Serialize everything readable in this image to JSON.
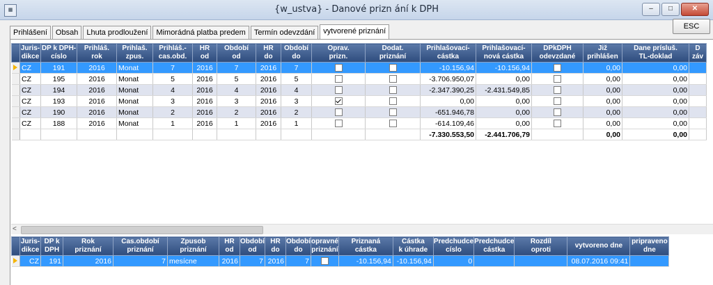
{
  "window": {
    "title": "{w_ustva} - Danové prizn ání k DPH",
    "icon": "app-window-icon"
  },
  "buttons": {
    "minimize": "–",
    "maximize": "□",
    "close": "✕",
    "esc": "ESC"
  },
  "tabs": [
    "Prihlášení",
    "Obsah",
    "Lhuta prodloužení",
    "Mimorádná platba predem",
    "Termín odevzdání",
    "vytvorené priznání"
  ],
  "top_grid": {
    "headers": [
      "Juris-\ndikce",
      "DP k DPH-\ncíslo",
      "Prihláš.\nrok",
      "Prihlaš.\nzpus.",
      "Prihláš.-\ncas.obd.",
      "HR\nod",
      "Období\nod",
      "HR\ndo",
      "Období\ndo",
      "Oprav.\nprizn.",
      "Dodat.\npriznání",
      "Prihlašovací-\ncástka",
      "Prihlašovací-\nnová cástka",
      "DPkDPH\nodevzdané",
      "Již\nprihlášen",
      "Dane prísluš.\nTL-doklad",
      "D\nzáv"
    ],
    "rows": [
      {
        "juris": "CZ",
        "dp": "191",
        "rok": "2016",
        "zpus": "Monat",
        "cas": "7",
        "hr_od": "2016",
        "ob_od": "7",
        "hr_do": "2016",
        "ob_do": "7",
        "oprav": false,
        "dodat": false,
        "castka": "-10.156,94",
        "nova": "-10.156,94",
        "odevz": false,
        "jiz": "0,00",
        "dane": "0,00"
      },
      {
        "juris": "CZ",
        "dp": "195",
        "rok": "2016",
        "zpus": "Monat",
        "cas": "5",
        "hr_od": "2016",
        "ob_od": "5",
        "hr_do": "2016",
        "ob_do": "5",
        "oprav": false,
        "dodat": false,
        "castka": "-3.706.950,07",
        "nova": "0,00",
        "odevz": false,
        "jiz": "0,00",
        "dane": "0,00"
      },
      {
        "juris": "CZ",
        "dp": "194",
        "rok": "2016",
        "zpus": "Monat",
        "cas": "4",
        "hr_od": "2016",
        "ob_od": "4",
        "hr_do": "2016",
        "ob_do": "4",
        "oprav": false,
        "dodat": false,
        "castka": "-2.347.390,25",
        "nova": "-2.431.549,85",
        "odevz": false,
        "jiz": "0,00",
        "dane": "0,00"
      },
      {
        "juris": "CZ",
        "dp": "193",
        "rok": "2016",
        "zpus": "Monat",
        "cas": "3",
        "hr_od": "2016",
        "ob_od": "3",
        "hr_do": "2016",
        "ob_do": "3",
        "oprav": true,
        "dodat": false,
        "castka": "0,00",
        "nova": "0,00",
        "odevz": false,
        "jiz": "0,00",
        "dane": "0,00"
      },
      {
        "juris": "CZ",
        "dp": "190",
        "rok": "2016",
        "zpus": "Monat",
        "cas": "2",
        "hr_od": "2016",
        "ob_od": "2",
        "hr_do": "2016",
        "ob_do": "2",
        "oprav": false,
        "dodat": false,
        "castka": "-651.946,78",
        "nova": "0,00",
        "odevz": false,
        "jiz": "0,00",
        "dane": "0,00"
      },
      {
        "juris": "CZ",
        "dp": "188",
        "rok": "2016",
        "zpus": "Monat",
        "cas": "1",
        "hr_od": "2016",
        "ob_od": "1",
        "hr_do": "2016",
        "ob_do": "1",
        "oprav": false,
        "dodat": false,
        "castka": "-614.109,46",
        "nova": "0,00",
        "odevz": false,
        "jiz": "0,00",
        "dane": "0,00"
      }
    ],
    "totals": {
      "castka": "-7.330.553,50",
      "nova": "-2.441.706,79",
      "jiz": "0,00",
      "dane": "0,00"
    }
  },
  "bottom_grid": {
    "headers": [
      "Juris-\ndikce",
      "DP k\nDPH",
      "Rok\npriznání",
      "Cas.období\npriznání",
      "Zpusob\npriznání",
      "HR\nod",
      "Období\nod",
      "HR\ndo",
      "Období\ndo",
      "opravné\npriznání",
      "Priznaná\ncástka",
      "Cástka\nk úhrade",
      "Predchudce\ncíslo",
      "Predchudce\ncástka",
      "Rozdíl\noproti",
      "vytvoreno dne",
      "pripraveno\ndne"
    ],
    "rows": [
      {
        "juris": "CZ",
        "dp": "191",
        "rok": "2016",
        "cas": "7",
        "zpus": "mesícne",
        "hr_od": "2016",
        "ob_od": "7",
        "hr_do": "2016",
        "ob_do": "7",
        "oprav": false,
        "castka": "-10.156,94",
        "uhrada": "-10.156,94",
        "pred_cislo": "0",
        "pred_castka": "",
        "rozdil": "",
        "vytvoreno": "08.07.2016 09:41",
        "pripraveno": ""
      }
    ]
  }
}
